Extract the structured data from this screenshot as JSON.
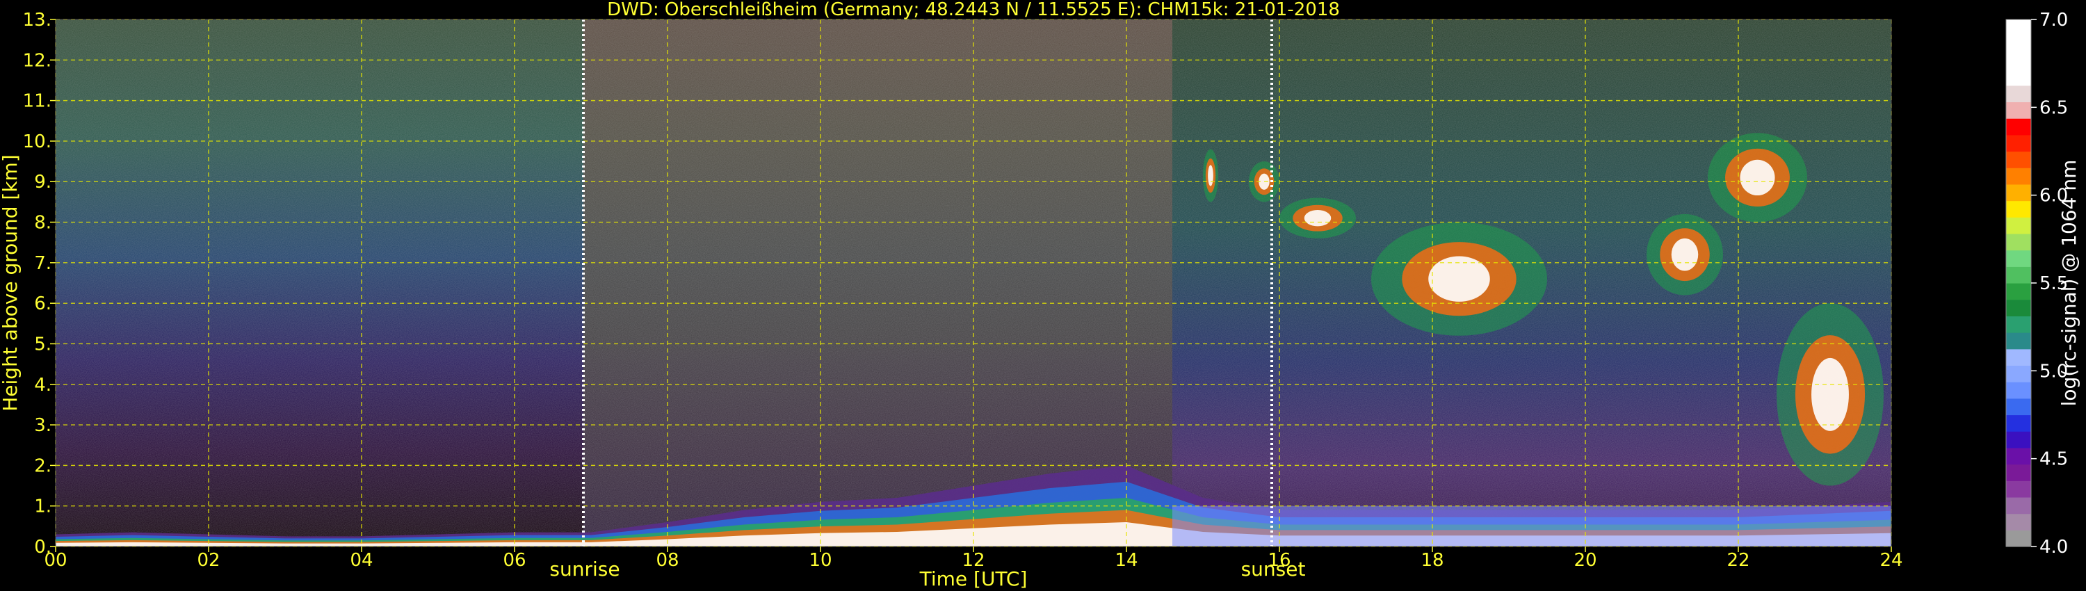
{
  "chart_data": {
    "type": "heatmap",
    "title": "DWD: Oberschleißheim (Germany; 48.2443 N / 11.5525 E):    CHM15k: 21-01-2018",
    "xlabel": "Time [UTC]",
    "ylabel": "Height above ground [km]",
    "xlim": [
      0,
      24
    ],
    "ylim": [
      0,
      13
    ],
    "x_ticks": [
      0,
      2,
      4,
      6,
      8,
      10,
      12,
      14,
      16,
      18,
      20,
      22,
      24
    ],
    "x_tick_labels": [
      "00",
      "02",
      "04",
      "06",
      "08",
      "10",
      "12",
      "14",
      "16",
      "18",
      "20",
      "22",
      "24"
    ],
    "y_ticks": [
      0,
      1,
      2,
      3,
      4,
      5,
      6,
      7,
      8,
      9,
      10,
      11,
      12,
      13
    ],
    "y_tick_labels": [
      "0.",
      "1.",
      "2.",
      "3.",
      "4.",
      "5.",
      "6.",
      "7.",
      "8.",
      "9.",
      "10.",
      "11.",
      "12.",
      "13."
    ],
    "grid": true,
    "annotations": [
      {
        "text": "sunrise",
        "x": 6.9
      },
      {
        "text": "sunset",
        "x": 15.9
      }
    ],
    "colorbar": {
      "label": "log(rc-signal) @ 1064 nm",
      "range": [
        4.0,
        7.0
      ],
      "ticks": [
        4.0,
        4.5,
        5.0,
        5.5,
        6.0,
        6.5,
        7.0
      ],
      "tick_labels": [
        "4.0",
        "4.5",
        "5.0",
        "5.5",
        "6.0",
        "6.5",
        "7.0"
      ]
    },
    "features": {
      "boundary_layer": [
        [
          0,
          0.3
        ],
        [
          1,
          0.35
        ],
        [
          2,
          0.3
        ],
        [
          3,
          0.25
        ],
        [
          4,
          0.25
        ],
        [
          5,
          0.3
        ],
        [
          6,
          0.35
        ],
        [
          7,
          0.35
        ],
        [
          8,
          0.6
        ],
        [
          9,
          0.9
        ],
        [
          10,
          1.1
        ],
        [
          11,
          1.2
        ],
        [
          12,
          1.5
        ],
        [
          13,
          1.8
        ],
        [
          14,
          2.0
        ],
        [
          15,
          1.2
        ],
        [
          16,
          0.9
        ],
        [
          17,
          0.9
        ],
        [
          18,
          0.9
        ],
        [
          19,
          0.9
        ],
        [
          20,
          0.9
        ],
        [
          21,
          0.9
        ],
        [
          22,
          0.9
        ],
        [
          23,
          1.0
        ],
        [
          24,
          1.1
        ]
      ],
      "cirrus": [
        {
          "t0": 15.0,
          "t1": 15.2,
          "h0": 8.5,
          "h1": 9.8
        },
        {
          "t0": 15.6,
          "t1": 16.0,
          "h0": 8.5,
          "h1": 9.5
        },
        {
          "t0": 16.0,
          "t1": 17.0,
          "h0": 7.6,
          "h1": 8.6
        },
        {
          "t0": 17.2,
          "t1": 19.5,
          "h0": 5.2,
          "h1": 8.0
        },
        {
          "t0": 20.8,
          "t1": 21.8,
          "h0": 6.2,
          "h1": 8.2
        },
        {
          "t0": 21.6,
          "t1": 22.9,
          "h0": 8.0,
          "h1": 10.2
        },
        {
          "t0": 22.5,
          "t1": 23.9,
          "h0": 1.5,
          "h1": 6.0
        }
      ]
    }
  }
}
